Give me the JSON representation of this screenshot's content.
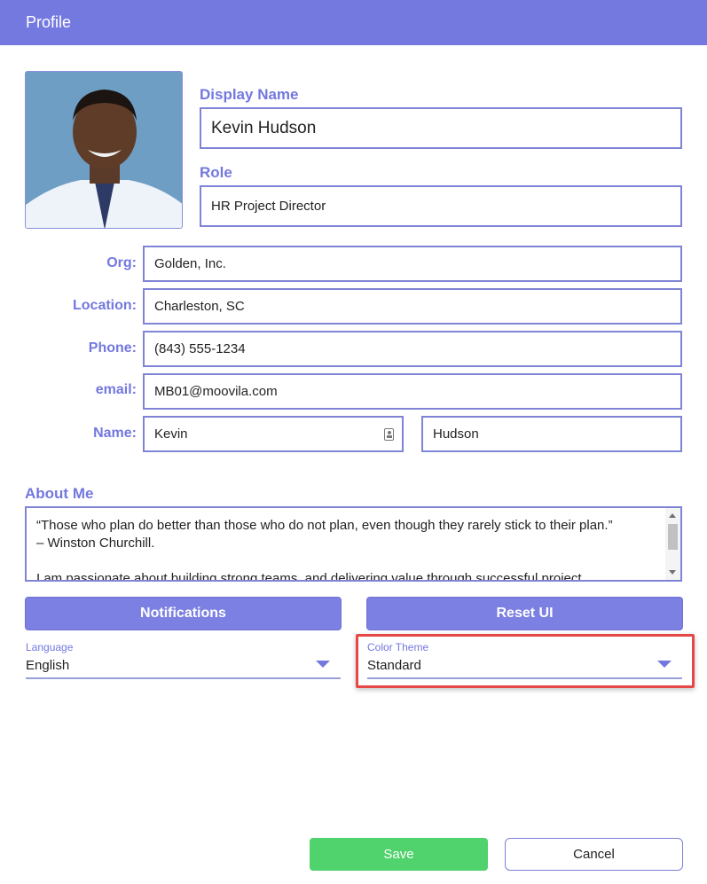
{
  "header": {
    "title": "Profile"
  },
  "profile": {
    "display_name_label": "Display Name",
    "display_name": "Kevin Hudson",
    "role_label": "Role",
    "role": "HR Project Director"
  },
  "fields": {
    "org_label": "Org:",
    "org": "Golden, Inc.",
    "location_label": "Location:",
    "location": "Charleston, SC",
    "phone_label": "Phone:",
    "phone": "(843) 555-1234",
    "email_label": "email:",
    "email": "MB01@moovila.com",
    "name_label": "Name:",
    "first_name": "Kevin",
    "last_name": "Hudson"
  },
  "about": {
    "label": "About Me",
    "text": "“Those who plan do better than those who do not plan, even though they rarely stick to their plan.”\n–  Winston Churchill.\n\nI am passionate about building strong  teams, and delivering value through successful project"
  },
  "buttons": {
    "notifications": "Notifications",
    "reset_ui": "Reset UI",
    "save": "Save",
    "cancel": "Cancel"
  },
  "language": {
    "label": "Language",
    "value": "English"
  },
  "color_theme": {
    "label": "Color Theme",
    "value": "Standard"
  },
  "colors": {
    "accent": "#7479e0",
    "save": "#50d26c",
    "highlight": "#e64848"
  },
  "icons": {
    "first_name_field": "contact-card-icon",
    "language_dropdown": "caret-down-icon",
    "theme_dropdown": "caret-down-icon"
  }
}
